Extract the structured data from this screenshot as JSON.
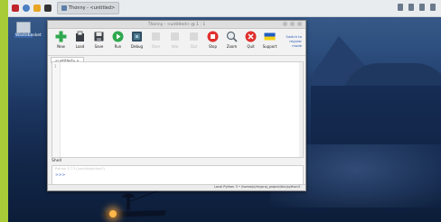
{
  "taskbar": {
    "task_label": "Thonny - <untitled>"
  },
  "desktop": {
    "icon_label": "Wastebasket"
  },
  "window": {
    "title": "Thonny - <untitled> @ 1 : 1",
    "mode_lines": [
      "Switch to",
      "regular",
      "mode"
    ],
    "tab_label": "<untitled> ×",
    "line_number": "1",
    "shell_title": "Shell",
    "shell_banner": "Python 3.7.3 (/usr/bin/python3)",
    "shell_prompt": ">>> ",
    "status": "Local Python 3 • /home/pi/myproj_project/bin/python3"
  },
  "toolbar": {
    "items": [
      {
        "label": "New",
        "icon": "plus-icon",
        "enabled": true
      },
      {
        "label": "Load",
        "icon": "load-icon",
        "enabled": true
      },
      {
        "label": "Save",
        "icon": "save-icon",
        "enabled": true
      },
      {
        "label": "Run",
        "icon": "run-icon",
        "enabled": true
      },
      {
        "label": "Debug",
        "icon": "debug-icon",
        "enabled": true
      },
      {
        "label": "Over",
        "icon": "step-over-icon",
        "enabled": false
      },
      {
        "label": "Into",
        "icon": "step-into-icon",
        "enabled": false
      },
      {
        "label": "Out",
        "icon": "step-out-icon",
        "enabled": false
      },
      {
        "label": "Stop",
        "icon": "stop-icon",
        "enabled": true
      },
      {
        "label": "Zoom",
        "icon": "zoom-icon",
        "enabled": true
      },
      {
        "label": "Quit",
        "icon": "quit-icon",
        "enabled": true
      },
      {
        "label": "Support",
        "icon": "support-flag-icon",
        "enabled": true
      }
    ]
  },
  "colors": {
    "frame_accent": "#a7cc37",
    "new_green": "#2fa84f",
    "run_green": "#2fa84f",
    "stop_red": "#e0302f",
    "quit_red": "#e0302f",
    "link_blue": "#2b5bb8"
  }
}
